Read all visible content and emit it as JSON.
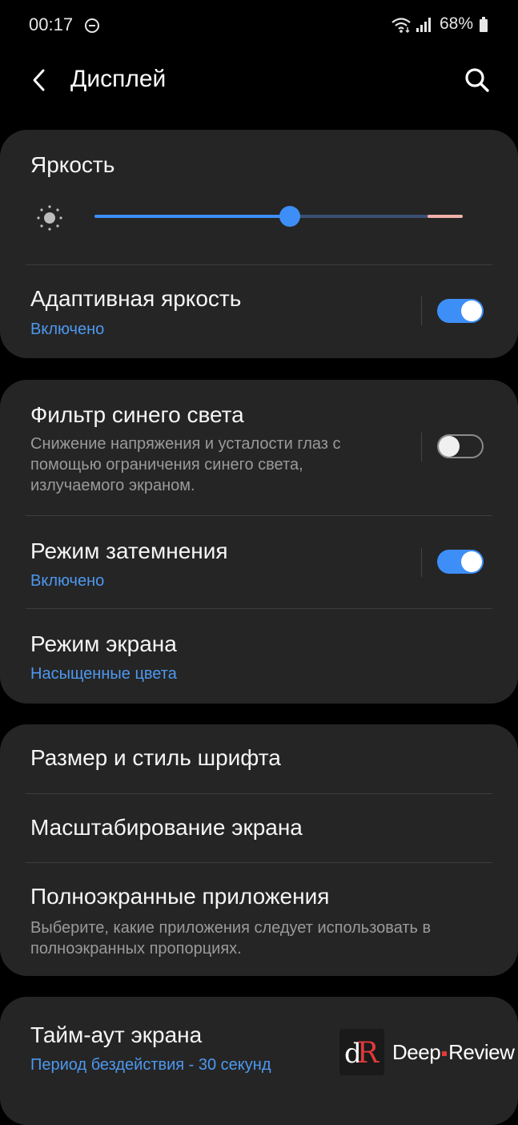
{
  "status_bar": {
    "time": "00:17",
    "battery_percent": "68%",
    "icons": [
      "do-not-disturb-icon",
      "wifi-icon",
      "signal-icon",
      "battery-icon"
    ]
  },
  "header": {
    "title": "Дисплей",
    "back_icon": "chevron-left-icon",
    "search_icon": "search-icon"
  },
  "brightness": {
    "label": "Яркость",
    "level": 0.53,
    "adaptive": {
      "title": "Адаптивная яркость",
      "status": "Включено",
      "enabled": true
    }
  },
  "blue_light": {
    "title": "Фильтр синего света",
    "description": "Снижение напряжения и усталости глаз с помощью ограничения синего света, излучаемого экраном.",
    "enabled": false
  },
  "dark_mode": {
    "title": "Режим затемнения",
    "status": "Включено",
    "enabled": true
  },
  "screen_mode": {
    "title": "Режим экрана",
    "value": "Насыщенные цвета"
  },
  "font": {
    "title": "Размер и стиль шрифта"
  },
  "zoom": {
    "title": "Масштабирование экрана"
  },
  "fullscreen_apps": {
    "title": "Полноэкранные приложения",
    "description": "Выберите, какие приложения следует использовать в полноэкранных пропорциях."
  },
  "timeout": {
    "title": "Тайм-аут экрана",
    "value": "Период бездействия - 30 секунд"
  },
  "watermark": {
    "logo_letters": "dR",
    "brand_word_1": "Deep",
    "brand_word_2": "Review"
  },
  "colors": {
    "accent": "#3e8ef7",
    "background": "#000000",
    "card": "#252525",
    "secondary_text": "#9a9a9a"
  }
}
